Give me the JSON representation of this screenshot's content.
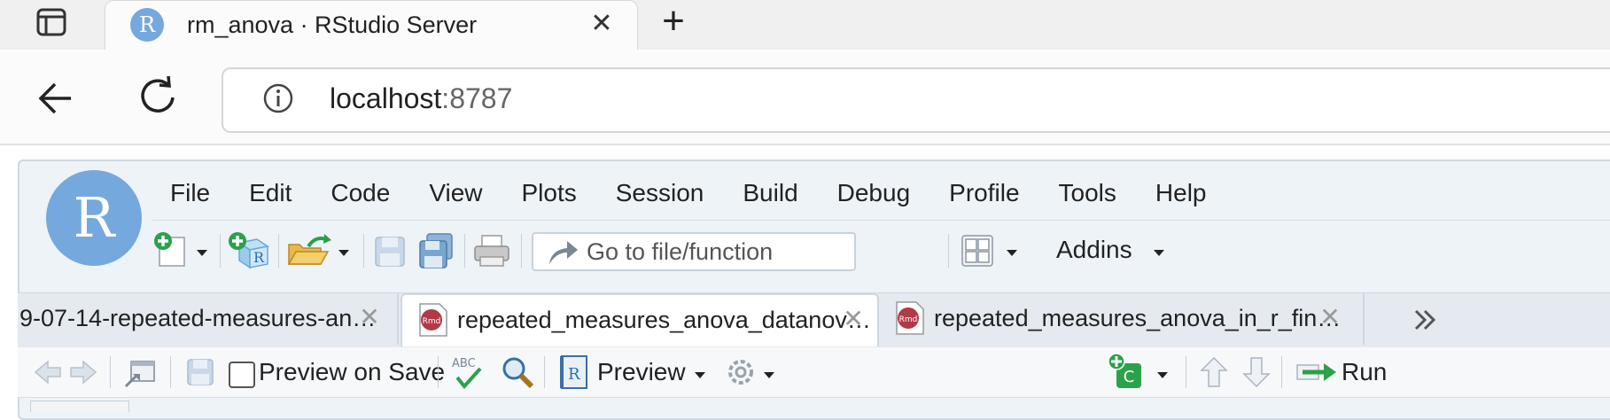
{
  "browser": {
    "tab": {
      "title": "rm_anova · RStudio Server",
      "favicon_letter": "R",
      "close_glyph": "✕"
    },
    "new_tab_glyph": "+",
    "address": {
      "host": "localhost",
      "port": ":8787"
    }
  },
  "rstudio": {
    "logo_letter": "R",
    "menu": [
      "File",
      "Edit",
      "Code",
      "View",
      "Plots",
      "Session",
      "Build",
      "Debug",
      "Profile",
      "Tools",
      "Help"
    ],
    "toolbar": {
      "goto_placeholder": "Go to file/function",
      "addins_label": "Addins"
    },
    "editor_tabs": [
      {
        "label": "9-07-14-repeated-measures-an…",
        "active": false,
        "has_icon": false
      },
      {
        "label": "repeated_measures_anova_datanov…",
        "active": true,
        "has_icon": true
      },
      {
        "label": "repeated_measures_anova_in_r_fin…",
        "active": false,
        "has_icon": true
      }
    ],
    "rmd_icon_text": "Rmd",
    "tab_close_glyph": "✕",
    "editor_toolbar": {
      "preview_on_save": "Preview on Save",
      "spell_text": "ABC",
      "preview": "Preview",
      "chunk_letter": "C",
      "run": "Run"
    }
  },
  "colors": {
    "r_blue": "#75a8dd",
    "rmd_red": "#b23a48",
    "green": "#2aa14a"
  }
}
